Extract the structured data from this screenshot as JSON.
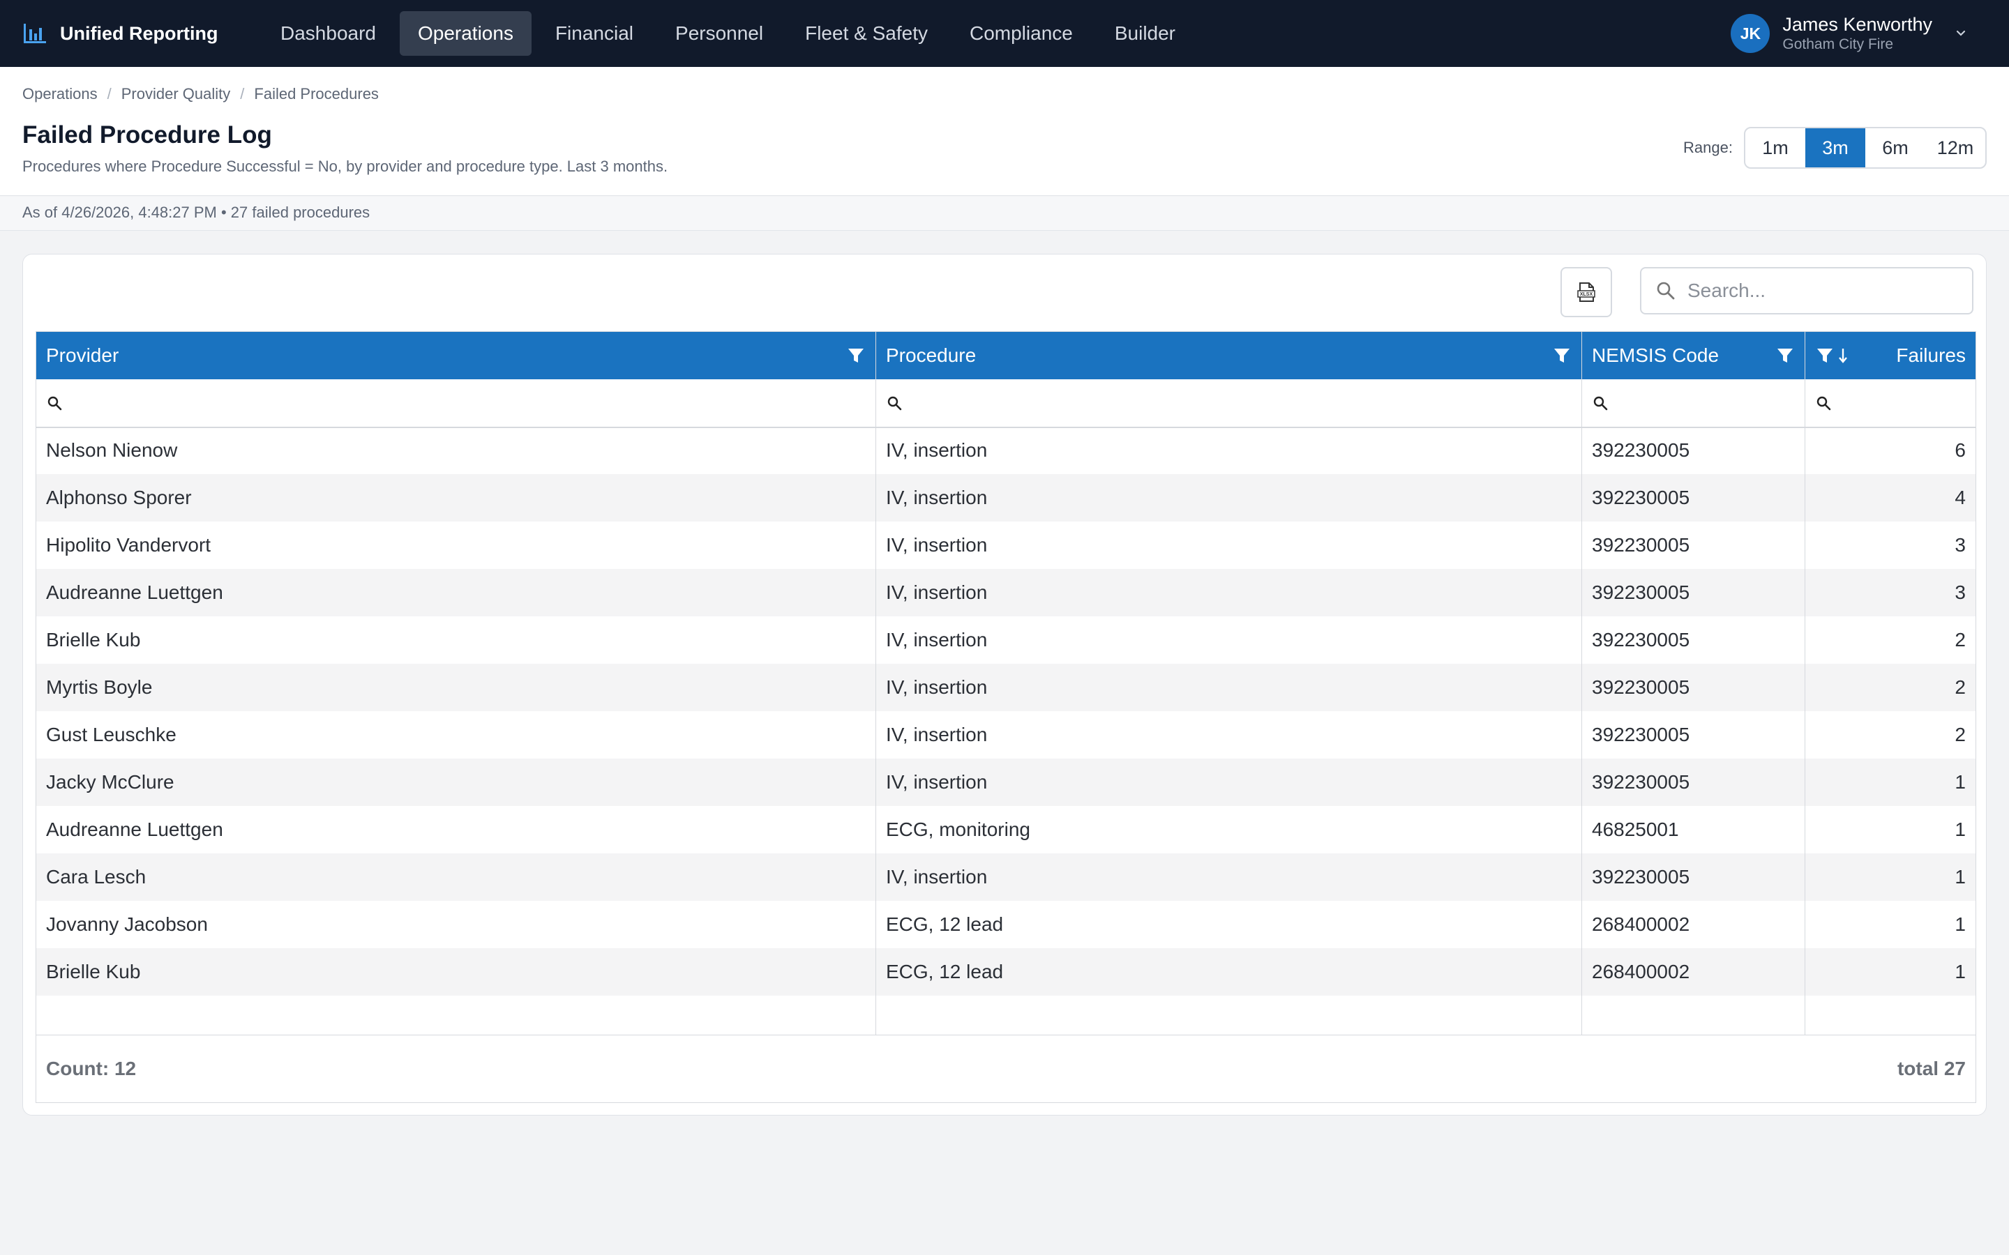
{
  "app": {
    "name": "Unified Reporting"
  },
  "nav": {
    "items": [
      {
        "label": "Dashboard",
        "active": false
      },
      {
        "label": "Operations",
        "active": true
      },
      {
        "label": "Financial",
        "active": false
      },
      {
        "label": "Personnel",
        "active": false
      },
      {
        "label": "Fleet & Safety",
        "active": false
      },
      {
        "label": "Compliance",
        "active": false
      },
      {
        "label": "Builder",
        "active": false
      }
    ]
  },
  "user": {
    "initials": "JK",
    "name": "James Kenworthy",
    "org": "Gotham City Fire"
  },
  "breadcrumb": [
    "Operations",
    "Provider Quality",
    "Failed Procedures"
  ],
  "page": {
    "title": "Failed Procedure Log",
    "subtitle": "Procedures where Procedure Successful = No, by provider and procedure type. Last 3 months.",
    "as_of": "As of 4/26/2026, 4:48:27 PM • 27 failed procedures"
  },
  "range": {
    "label": "Range:",
    "options": [
      "1m",
      "3m",
      "6m",
      "12m"
    ],
    "selected": "3m"
  },
  "toolbar": {
    "export_icon": "xlsx-export-icon",
    "search_placeholder": "Search..."
  },
  "table": {
    "columns": [
      "Provider",
      "Procedure",
      "NEMSIS Code",
      "Failures"
    ],
    "sorted_column": "Failures",
    "sort_direction": "descending",
    "rows": [
      [
        "Nelson Nienow",
        "IV, insertion",
        "392230005",
        "6"
      ],
      [
        "Alphonso Sporer",
        "IV, insertion",
        "392230005",
        "4"
      ],
      [
        "Hipolito Vandervort",
        "IV, insertion",
        "392230005",
        "3"
      ],
      [
        "Audreanne Luettgen",
        "IV, insertion",
        "392230005",
        "3"
      ],
      [
        "Brielle Kub",
        "IV, insertion",
        "392230005",
        "2"
      ],
      [
        "Myrtis Boyle",
        "IV, insertion",
        "392230005",
        "2"
      ],
      [
        "Gust Leuschke",
        "IV, insertion",
        "392230005",
        "2"
      ],
      [
        "Jacky McClure",
        "IV, insertion",
        "392230005",
        "1"
      ],
      [
        "Audreanne Luettgen",
        "ECG, monitoring",
        "46825001",
        "1"
      ],
      [
        "Cara Lesch",
        "IV, insertion",
        "392230005",
        "1"
      ],
      [
        "Jovanny Jacobson",
        "ECG, 12 lead",
        "268400002",
        "1"
      ],
      [
        "Brielle Kub",
        "ECG, 12 lead",
        "268400002",
        "1"
      ]
    ],
    "footer": {
      "count": "Count: 12",
      "total": "total 27"
    }
  },
  "colors": {
    "nav_bg": "#111a2b",
    "accent": "#1a73c0",
    "avatar": "#1a6fbf"
  }
}
